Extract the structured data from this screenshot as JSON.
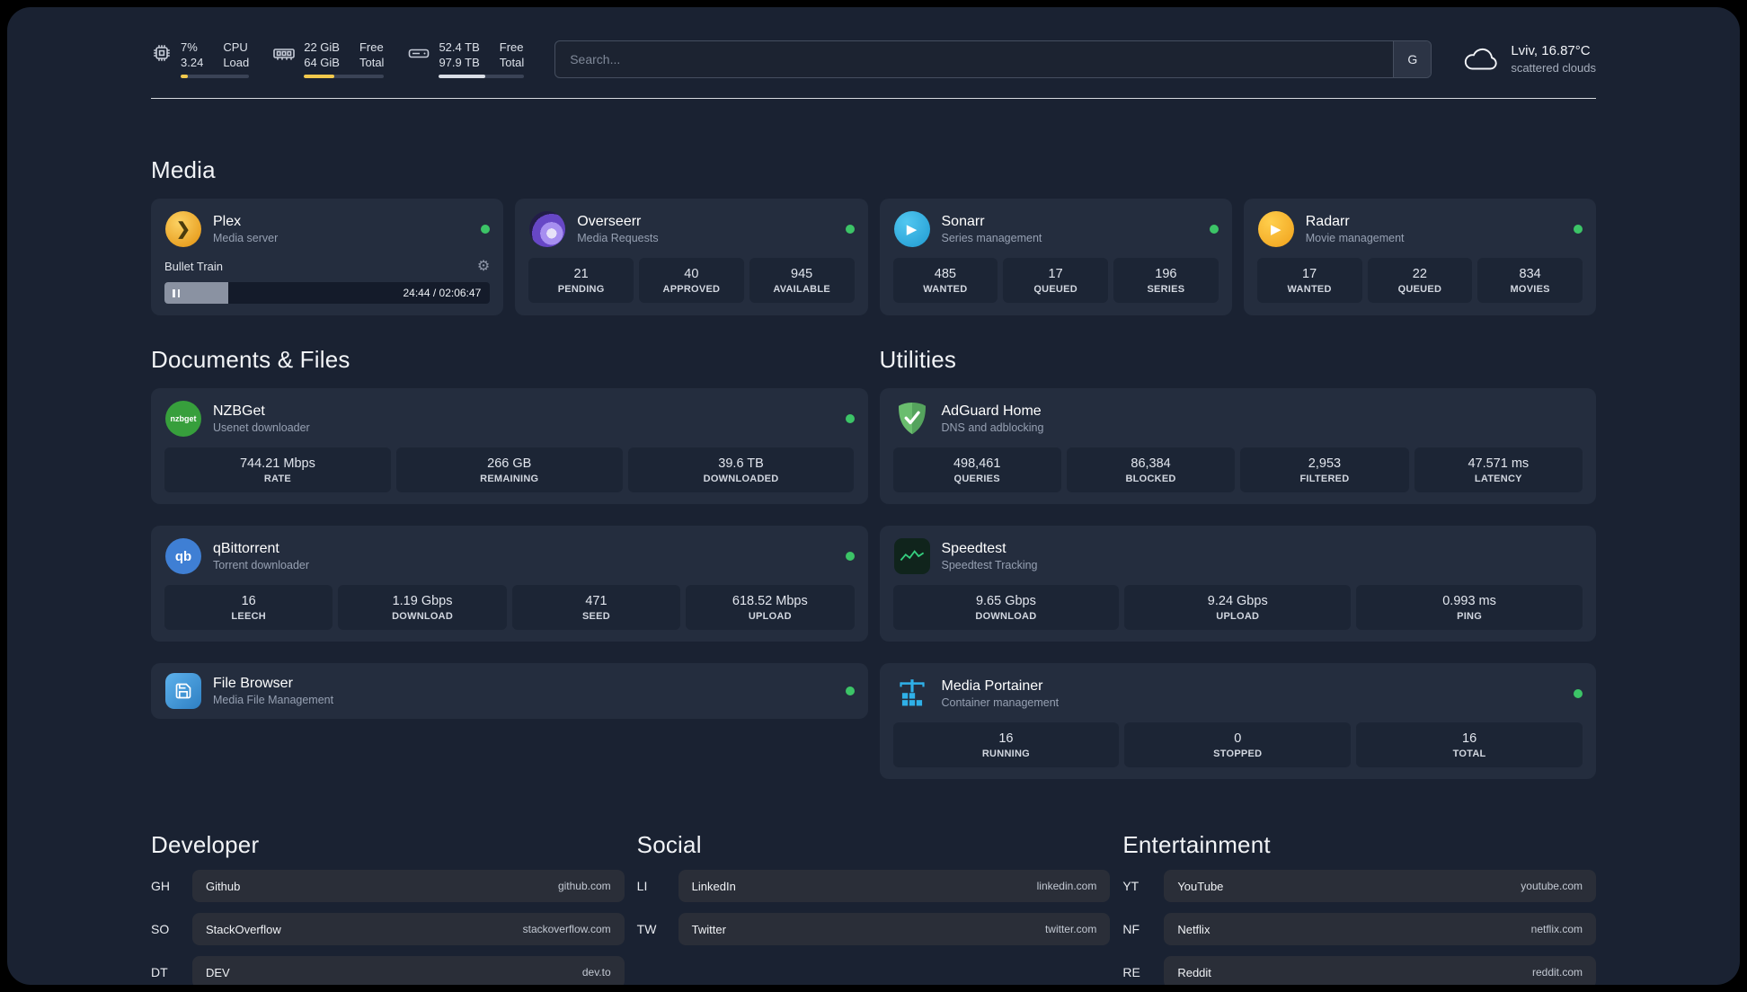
{
  "colors": {
    "background": "#1a2232",
    "card": "#242d3e",
    "tile": "#1c2535",
    "status_online": "#3cc467",
    "accent_yellow": "#f2c94c"
  },
  "icon_text": {
    "plex": "❯",
    "sonarr": "▶",
    "radarr": "▶",
    "nzbget": "nzbget",
    "qbittorrent": "qb",
    "gear": "⚙"
  },
  "topbar": {
    "cpu": {
      "value": "7%",
      "secondary": "3.24",
      "label_top": "CPU",
      "label_bottom": "Load",
      "bar_percent": 10
    },
    "ram": {
      "value": "22 GiB",
      "secondary": "64 GiB",
      "label_top": "Free",
      "label_bottom": "Total",
      "bar_percent": 38
    },
    "disk": {
      "value": "52.4 TB",
      "secondary": "97.9 TB",
      "label_top": "Free",
      "label_bottom": "Total",
      "bar_percent": 54
    },
    "search": {
      "placeholder": "Search...",
      "button_label": "G"
    },
    "weather": {
      "location": "Lviv, 16.87°C",
      "condition": "scattered clouds"
    }
  },
  "section_titles": {
    "media": "Media",
    "documents": "Documents & Files",
    "utilities": "Utilities",
    "developer": "Developer",
    "social": "Social",
    "entertainment": "Entertainment"
  },
  "apps": {
    "plex": {
      "name": "Plex",
      "subtitle": "Media server",
      "now_playing": "Bullet Train",
      "progress_time": "24:44 / 02:06:47",
      "progress_percent": 19.5
    },
    "overseerr": {
      "name": "Overseerr",
      "subtitle": "Media Requests",
      "stats": [
        {
          "value": "21",
          "label": "PENDING"
        },
        {
          "value": "40",
          "label": "APPROVED"
        },
        {
          "value": "945",
          "label": "AVAILABLE"
        }
      ]
    },
    "sonarr": {
      "name": "Sonarr",
      "subtitle": "Series management",
      "stats": [
        {
          "value": "485",
          "label": "WANTED"
        },
        {
          "value": "17",
          "label": "QUEUED"
        },
        {
          "value": "196",
          "label": "SERIES"
        }
      ]
    },
    "radarr": {
      "name": "Radarr",
      "subtitle": "Movie management",
      "stats": [
        {
          "value": "17",
          "label": "WANTED"
        },
        {
          "value": "22",
          "label": "QUEUED"
        },
        {
          "value": "834",
          "label": "MOVIES"
        }
      ]
    },
    "nzbget": {
      "name": "NZBGet",
      "subtitle": "Usenet downloader",
      "stats": [
        {
          "value": "744.21 Mbps",
          "label": "RATE"
        },
        {
          "value": "266 GB",
          "label": "REMAINING"
        },
        {
          "value": "39.6 TB",
          "label": "DOWNLOADED"
        }
      ]
    },
    "qbittorrent": {
      "name": "qBittorrent",
      "subtitle": "Torrent downloader",
      "stats": [
        {
          "value": "16",
          "label": "LEECH"
        },
        {
          "value": "1.19 Gbps",
          "label": "DOWNLOAD"
        },
        {
          "value": "471",
          "label": "SEED"
        },
        {
          "value": "618.52 Mbps",
          "label": "UPLOAD"
        }
      ]
    },
    "filebrowser": {
      "name": "File Browser",
      "subtitle": "Media File Management"
    },
    "adguard": {
      "name": "AdGuard Home",
      "subtitle": "DNS and adblocking",
      "stats": [
        {
          "value": "498,461",
          "label": "QUERIES"
        },
        {
          "value": "86,384",
          "label": "BLOCKED"
        },
        {
          "value": "2,953",
          "label": "FILTERED"
        },
        {
          "value": "47.571 ms",
          "label": "LATENCY"
        }
      ]
    },
    "speedtest": {
      "name": "Speedtest",
      "subtitle": "Speedtest Tracking",
      "stats": [
        {
          "value": "9.65 Gbps",
          "label": "DOWNLOAD"
        },
        {
          "value": "9.24 Gbps",
          "label": "UPLOAD"
        },
        {
          "value": "0.993 ms",
          "label": "PING"
        }
      ]
    },
    "portainer": {
      "name": "Media Portainer",
      "subtitle": "Container management",
      "stats": [
        {
          "value": "16",
          "label": "RUNNING"
        },
        {
          "value": "0",
          "label": "STOPPED"
        },
        {
          "value": "16",
          "label": "TOTAL"
        }
      ]
    }
  },
  "bookmarks": {
    "developer": [
      {
        "abbr": "GH",
        "name": "Github",
        "url": "github.com"
      },
      {
        "abbr": "SO",
        "name": "StackOverflow",
        "url": "stackoverflow.com"
      },
      {
        "abbr": "DT",
        "name": "DEV",
        "url": "dev.to"
      }
    ],
    "social": [
      {
        "abbr": "LI",
        "name": "LinkedIn",
        "url": "linkedin.com"
      },
      {
        "abbr": "TW",
        "name": "Twitter",
        "url": "twitter.com"
      }
    ],
    "entertainment": [
      {
        "abbr": "YT",
        "name": "YouTube",
        "url": "youtube.com"
      },
      {
        "abbr": "NF",
        "name": "Netflix",
        "url": "netflix.com"
      },
      {
        "abbr": "RE",
        "name": "Reddit",
        "url": "reddit.com"
      }
    ]
  }
}
